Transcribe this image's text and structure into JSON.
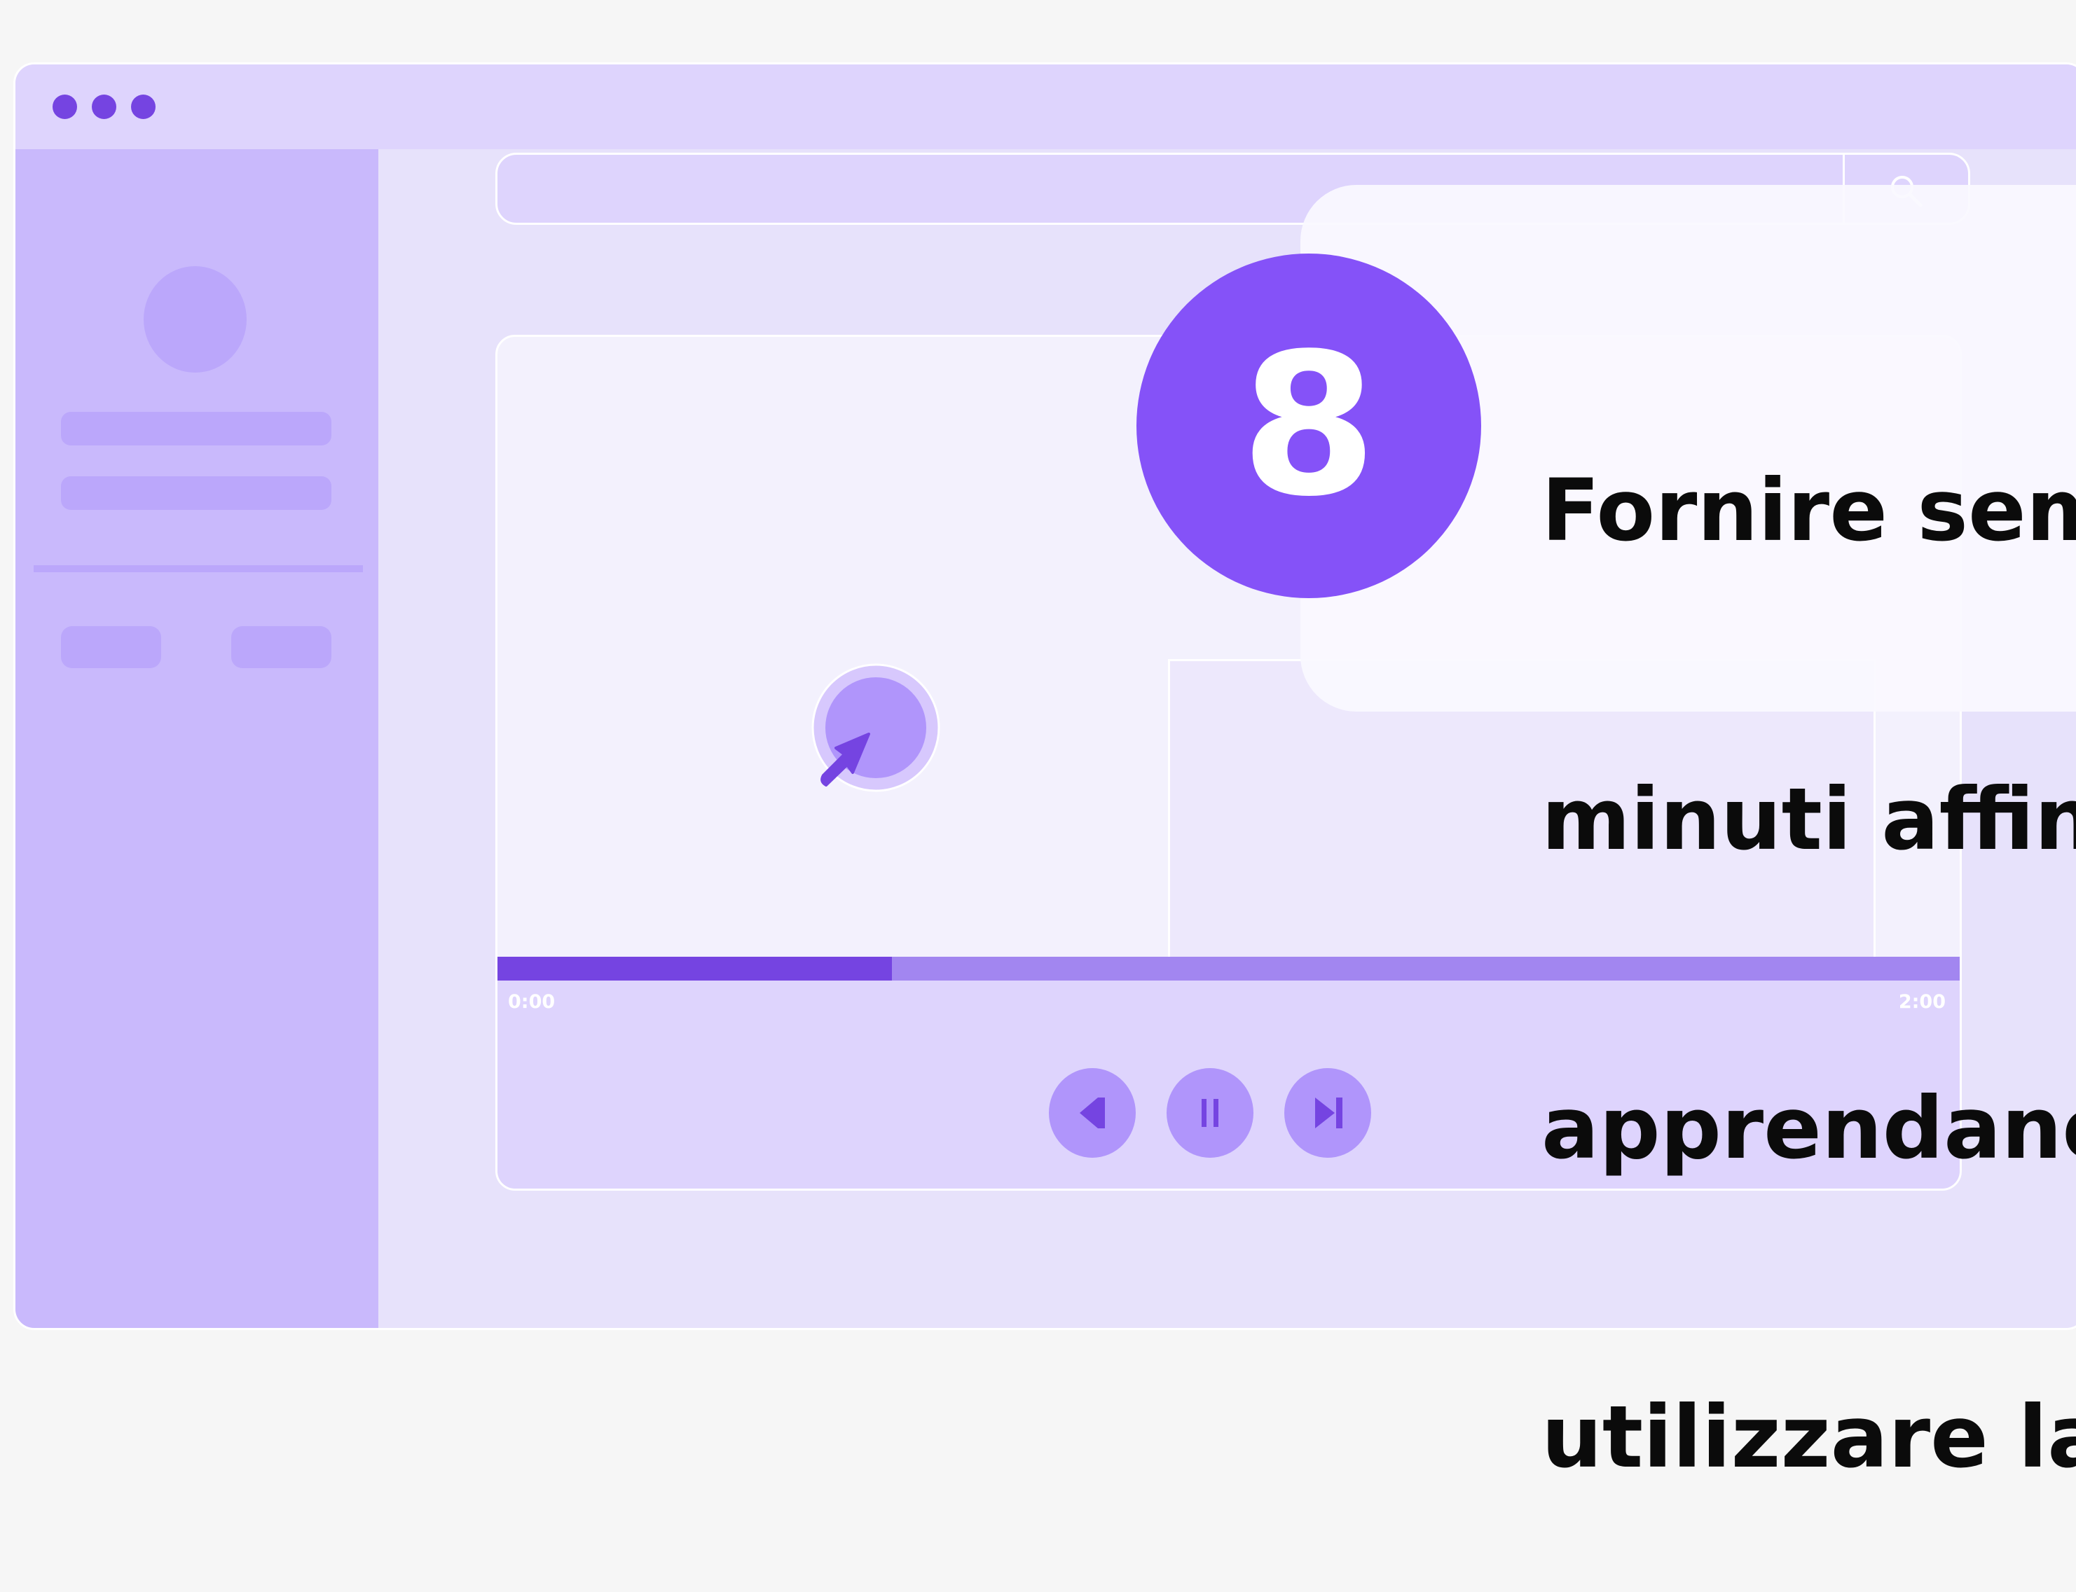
{
  "player": {
    "current_time": "0:00",
    "duration": "2:00",
    "progress_fraction": 0.27,
    "controls": [
      "previous",
      "pause",
      "next"
    ]
  },
  "callout": {
    "step_number": "8",
    "text_lines": [
      "Fornire semp",
      "minuti affina",
      "apprendano",
      "utilizzare la t"
    ]
  },
  "icons": {
    "search": "search-icon",
    "cursor": "cursor-arrow-icon",
    "previous": "previous-icon",
    "pause": "pause-icon",
    "next": "skip-next-icon"
  },
  "colors": {
    "accent": "#7544e1",
    "step_badge": "#8552f8",
    "sidebar": "#c9b9fc",
    "titlebar": "#ded4fd"
  }
}
